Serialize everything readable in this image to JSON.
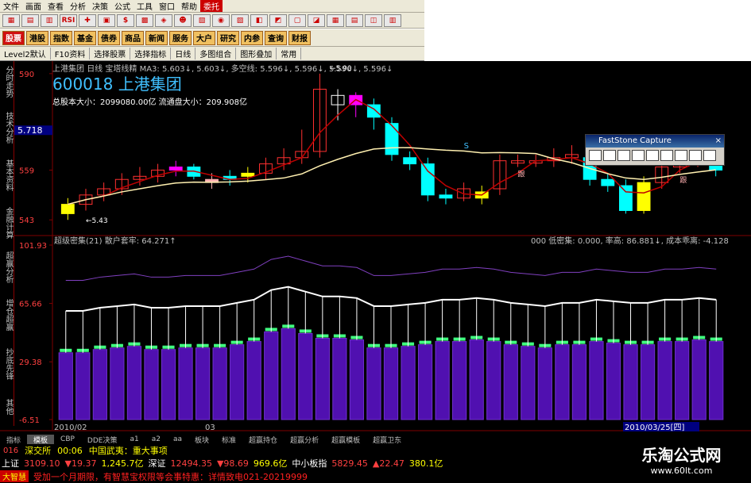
{
  "menu": [
    "文件",
    "画面",
    "查看",
    "分析",
    "决策",
    "公式",
    "工具",
    "窗口",
    "帮助",
    "委托"
  ],
  "toolbar": {
    "rsi": "RSI"
  },
  "nav": [
    "股票",
    "港股",
    "指数",
    "基金",
    "债券",
    "商品",
    "新闻",
    "服务",
    "大户",
    "研究",
    "内参",
    "查询",
    "财报"
  ],
  "subbar": [
    "Level2默认",
    "F10资料",
    "选择股票",
    "选择指标",
    "日线",
    "多图组合",
    "图形叠加",
    "常用"
  ],
  "sidetabs": [
    "分时走势",
    "技术分析",
    "基本资料",
    "金融计算",
    "超赢分析",
    "增仓超赢",
    "抄底先锋",
    "其他"
  ],
  "stock": {
    "short": "上港集团",
    "period": "日线",
    "indicator": "宝塔线精",
    "ma_line": "MA3: 5.603↓, 5.603↓, 多空线: 5.596↓, 5.596↓, 5.596↓, 5.596↓",
    "code": "600018",
    "name": "上港集团",
    "total_shares": "总股本大小：2099080.00亿",
    "float_shares": "流通盘大小：209.908亿"
  },
  "lower": {
    "left_label": "超级密集(21) 散户套牢: 64.271↑",
    "right_label": "000 低密集: 0.000, 率高: 86.881↓, 成本乖离: -4.128"
  },
  "faststone": {
    "title": "FastStone Capture"
  },
  "bottomtabs": [
    "指标",
    "模板",
    "CBP",
    "DDE决策",
    "a1",
    "a2",
    "aa",
    "板块",
    "标准",
    "超赢持仓",
    "超赢分析",
    "超赢模板",
    "超赢卫东"
  ],
  "news": {
    "index": "016",
    "source": "深交所",
    "time": "00:06",
    "headline": "中国武夷：重大事项"
  },
  "ticker": {
    "sh_label": "上证",
    "sh_value": "3109.10",
    "sh_change": "▼19.37",
    "sh_amount": "1,245.7亿",
    "sz_label": "深证",
    "sz_value": "12494.35",
    "sz_change": "▼98.69",
    "sz_amount": "969.6亿",
    "smb_label": "中小板指",
    "smb_value": "5829.45",
    "smb_change": "▲22.47",
    "smb_amount": "380.1亿"
  },
  "marquee": {
    "logo": "大智慧",
    "text": "受加一个月期限，有智慧宝权限等会事特惠：详情致电021-20219999"
  },
  "watermark": {
    "title": "乐淘公式网",
    "url": "www.60lt.com"
  },
  "chart_data": [
    {
      "type": "candlestick",
      "title": "600018 上港集团",
      "yticks": [
        "590",
        "559",
        "543"
      ],
      "current_price_label": "5.718",
      "annotations": [
        "5.90",
        "5.43",
        "S",
        "跟"
      ],
      "xlabels": [
        "2010/02",
        "03"
      ],
      "cursor_date": "2010/03/25[四]",
      "candles": [
        {
          "o": 545,
          "c": 548,
          "h": 550,
          "l": 543,
          "color": "yellow"
        },
        {
          "o": 548,
          "c": 551,
          "h": 553,
          "l": 546,
          "color": "red"
        },
        {
          "o": 551,
          "c": 553,
          "h": 555,
          "l": 549,
          "color": "red"
        },
        {
          "o": 553,
          "c": 556,
          "h": 558,
          "l": 551,
          "color": "red"
        },
        {
          "o": 556,
          "c": 557,
          "h": 560,
          "l": 554,
          "color": "red"
        },
        {
          "o": 557,
          "c": 559,
          "h": 561,
          "l": 555,
          "color": "red"
        },
        {
          "o": 559,
          "c": 560,
          "h": 562,
          "l": 557,
          "color": "magenta"
        },
        {
          "o": 560,
          "c": 557,
          "h": 561,
          "l": 556,
          "color": "cyan"
        },
        {
          "o": 556,
          "c": 555,
          "h": 558,
          "l": 553,
          "color": "pink"
        },
        {
          "o": 557,
          "c": 556,
          "h": 559,
          "l": 554,
          "color": "cyan"
        },
        {
          "o": 557,
          "c": 558,
          "h": 560,
          "l": 555,
          "color": "yellow"
        },
        {
          "o": 558,
          "c": 561,
          "h": 563,
          "l": 556,
          "color": "red"
        },
        {
          "o": 561,
          "c": 563,
          "h": 566,
          "l": 559,
          "color": "red"
        },
        {
          "o": 563,
          "c": 565,
          "h": 572,
          "l": 561,
          "color": "red"
        },
        {
          "o": 565,
          "c": 585,
          "h": 590,
          "l": 563,
          "color": "red"
        },
        {
          "o": 583,
          "c": 580,
          "h": 585,
          "l": 575,
          "color": "white"
        },
        {
          "o": 583,
          "c": 580,
          "h": 584,
          "l": 576,
          "color": "magenta"
        },
        {
          "o": 580,
          "c": 576,
          "h": 582,
          "l": 572,
          "color": "cyan"
        },
        {
          "o": 574,
          "c": 564,
          "h": 576,
          "l": 562,
          "color": "cyan"
        },
        {
          "o": 563,
          "c": 561,
          "h": 565,
          "l": 559,
          "color": "cyan"
        },
        {
          "o": 561,
          "c": 551,
          "h": 563,
          "l": 549,
          "color": "cyan"
        },
        {
          "o": 551,
          "c": 550,
          "h": 553,
          "l": 548,
          "color": "cyan"
        },
        {
          "o": 550,
          "c": 553,
          "h": 555,
          "l": 549,
          "color": "red"
        },
        {
          "o": 552,
          "c": 550,
          "h": 554,
          "l": 548,
          "color": "yellow"
        },
        {
          "o": 553,
          "c": 562,
          "h": 564,
          "l": 551,
          "color": "red"
        },
        {
          "o": 562,
          "c": 562,
          "h": 564,
          "l": 560,
          "color": "red"
        },
        {
          "o": 562,
          "c": 562,
          "h": 564,
          "l": 560,
          "color": "red"
        },
        {
          "o": 562,
          "c": 563,
          "h": 566,
          "l": 560,
          "color": "red"
        },
        {
          "o": 563,
          "c": 564,
          "h": 567,
          "l": 561,
          "color": "red"
        },
        {
          "o": 563,
          "c": 556,
          "h": 565,
          "l": 554,
          "color": "cyan"
        },
        {
          "o": 556,
          "c": 554,
          "h": 558,
          "l": 552,
          "color": "cyan"
        },
        {
          "o": 554,
          "c": 546,
          "h": 556,
          "l": 545,
          "color": "cyan"
        },
        {
          "o": 546,
          "c": 555,
          "h": 557,
          "l": 545,
          "color": "yellow"
        },
        {
          "o": 555,
          "c": 560,
          "h": 562,
          "l": 553,
          "color": "red"
        },
        {
          "o": 560,
          "c": 562,
          "h": 564,
          "l": 558,
          "color": "red"
        },
        {
          "o": 562,
          "c": 563,
          "h": 565,
          "l": 560,
          "color": "red"
        },
        {
          "o": 563,
          "c": 559,
          "h": 565,
          "l": 557,
          "color": "cyan"
        }
      ]
    },
    {
      "type": "bar",
      "title": "超级密集(21)",
      "yticks": [
        "101.93",
        "65.66",
        "29.38",
        "-6.51"
      ],
      "values": [
        35,
        35,
        37,
        38,
        39,
        37,
        37,
        38,
        38,
        38,
        40,
        42,
        48,
        50,
        47,
        44,
        44,
        43,
        38,
        38,
        39,
        40,
        42,
        42,
        43,
        42,
        40,
        39,
        38,
        40,
        40,
        42,
        41,
        40,
        40,
        42,
        42,
        43,
        42
      ]
    }
  ]
}
